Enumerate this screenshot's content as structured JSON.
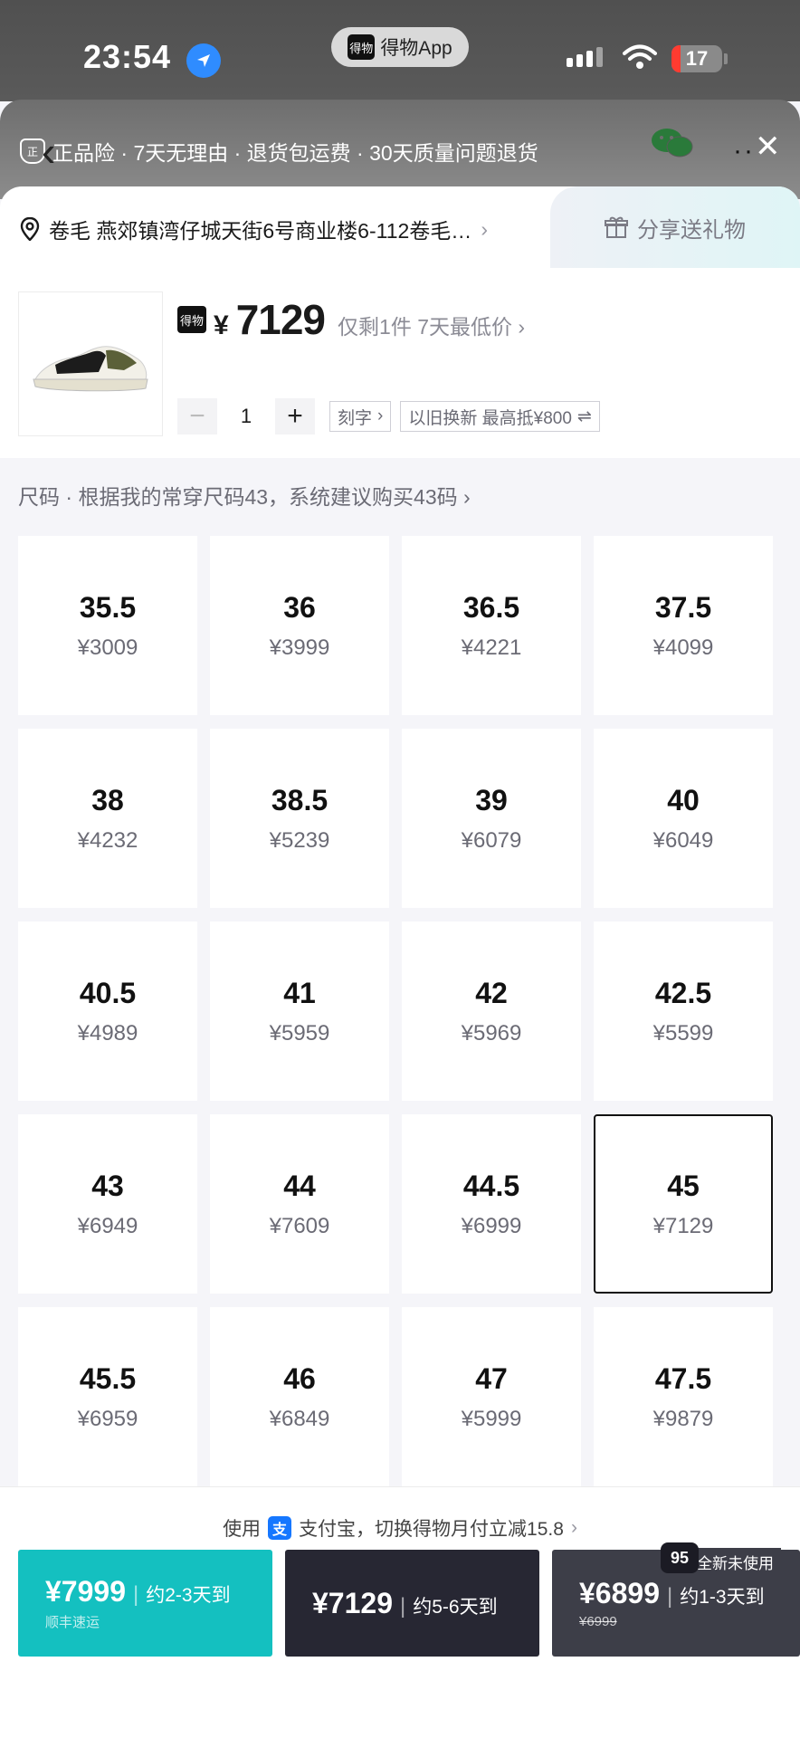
{
  "status_bar": {
    "time": "23:54",
    "app_pill": "得物App",
    "app_logo_text": "得物",
    "battery": "17",
    "battery_level": 0.17
  },
  "header": {
    "guarantee_text": "正品险 · 7天无理由 · 退货包运费 · 30天质量问题退货",
    "shield_text": "正"
  },
  "address": {
    "text": "卷毛 燕郊镇湾仔城天街6号商业楼6-112卷毛…",
    "share_label": "分享送礼物"
  },
  "product": {
    "logo_text": "得物",
    "currency": "¥",
    "price": "7129",
    "note": "仅剩1件 7天最低价",
    "quantity": "1",
    "engrave_label": "刻字",
    "tradein_label": "以旧换新 最高抵¥800"
  },
  "size_section": {
    "hint": "尺码 · 根据我的常穿尺码43，系统建议购买43码",
    "selected": "45",
    "sizes": [
      {
        "size": "35.5",
        "price": "¥3009"
      },
      {
        "size": "36",
        "price": "¥3999"
      },
      {
        "size": "36.5",
        "price": "¥4221"
      },
      {
        "size": "37.5",
        "price": "¥4099"
      },
      {
        "size": "38",
        "price": "¥4232"
      },
      {
        "size": "38.5",
        "price": "¥5239"
      },
      {
        "size": "39",
        "price": "¥6079"
      },
      {
        "size": "40",
        "price": "¥6049"
      },
      {
        "size": "40.5",
        "price": "¥4989"
      },
      {
        "size": "41",
        "price": "¥5959"
      },
      {
        "size": "42",
        "price": "¥5969"
      },
      {
        "size": "42.5",
        "price": "¥5599"
      },
      {
        "size": "43",
        "price": "¥6949"
      },
      {
        "size": "44",
        "price": "¥7609"
      },
      {
        "size": "44.5",
        "price": "¥6999"
      },
      {
        "size": "45",
        "price": "¥7129"
      },
      {
        "size": "45.5",
        "price": "¥6959"
      },
      {
        "size": "46",
        "price": "¥6849"
      },
      {
        "size": "47",
        "price": "¥5999"
      },
      {
        "size": "47.5",
        "price": "¥9879"
      }
    ]
  },
  "bottom": {
    "alipay_prefix": "使用",
    "alipay_icon_text": "支",
    "alipay_text": "支付宝，切换得物月付立减15.8",
    "options": [
      {
        "price": "¥7999",
        "eta": "约2-3天到",
        "sub": "顺丰速运"
      },
      {
        "price": "¥7129",
        "eta": "约5-6天到"
      },
      {
        "price": "¥6899",
        "eta": "约1-3天到",
        "sub": "¥6999",
        "badge_num": "95",
        "badge_text": "全新未使用"
      }
    ]
  },
  "colors": {
    "accent_teal": "#14c0c0",
    "dark_button": "#272733",
    "battery_red": "#ff3b30",
    "alipay_blue": "#1677ff"
  }
}
